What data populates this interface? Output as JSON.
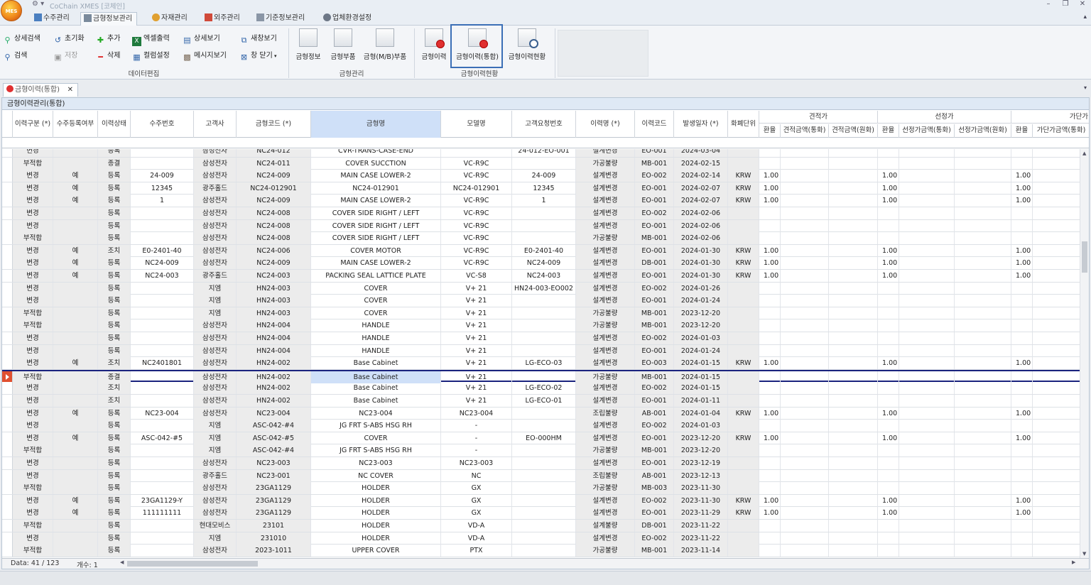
{
  "window": {
    "title": "CoChain XMES [코체인]",
    "logo_text": "MES"
  },
  "menu_tabs": [
    "수주관리",
    "금형정보관리",
    "자재관리",
    "외주관리",
    "기준정보관리",
    "업체환경설정"
  ],
  "ribbon": {
    "data_edit": {
      "label": "데이터편집",
      "buttons": [
        "상세검색",
        "검색",
        "초기화",
        "저장",
        "추가",
        "삭제",
        "엑셀출력",
        "컬럼설정",
        "상세보기",
        "메시지보기",
        "새창보기",
        "창 닫기"
      ]
    },
    "mold_mgmt": {
      "label": "금형관리",
      "buttons": [
        "금형정보",
        "금형부품",
        "금형(M/B)부품"
      ]
    },
    "mold_history": {
      "label": "금형이력현황",
      "buttons": [
        "금형이력",
        "금형이력(통합)",
        "금형이력현황"
      ]
    }
  },
  "doc_tab": "금형이력(통합)",
  "panel_title": "금형이력관리(통합)",
  "columns": [
    "이력구분 (*)",
    "수주등록여부",
    "이력상태",
    "수주번호",
    "고객사",
    "금형코드 (*)",
    "금형명",
    "모델명",
    "고객요청번호",
    "이력명 (*)",
    "이력코드",
    "발생일자 (*)",
    "화폐단위"
  ],
  "group_headers": {
    "estimate": "견적가",
    "selected": "선정가",
    "processing": "가단가"
  },
  "group_cols": {
    "estimate": [
      "환율",
      "견적금액(통화)",
      "견적금액(원화)"
    ],
    "selected": [
      "환율",
      "선정가금액(통화)",
      "선정가금액(원화)"
    ],
    "processing": [
      "환율",
      "가단가금액(통화)"
    ]
  },
  "rows": [
    [
      "변경",
      "",
      "등록",
      "",
      "삼성전자",
      "NC24-012",
      "CVR-TRANS-CASE-END",
      "",
      "24-012-EO-001",
      "설계변경",
      "EO-001",
      "2024-03-04",
      "",
      "",
      "",
      ""
    ],
    [
      "부적합",
      "",
      "종결",
      "",
      "삼성전자",
      "NC24-011",
      "COVER SUCCTION",
      "VC-R9C",
      "",
      "가공불량",
      "MB-001",
      "2024-02-15",
      "",
      "",
      "",
      ""
    ],
    [
      "변경",
      "예",
      "등록",
      "24-009",
      "삼성전자",
      "NC24-009",
      "MAIN CASE LOWER-2",
      "VC-R9C",
      "24-009",
      "설계변경",
      "EO-002",
      "2024-02-14",
      "KRW",
      "1.00",
      "1.00",
      "1.00"
    ],
    [
      "변경",
      "예",
      "등록",
      "12345",
      "광주홀드",
      "NC24-012901",
      "NC24-012901",
      "NC24-012901",
      "12345",
      "설계변경",
      "EO-001",
      "2024-02-07",
      "KRW",
      "1.00",
      "1.00",
      "1.00"
    ],
    [
      "변경",
      "예",
      "등록",
      "1",
      "삼성전자",
      "NC24-009",
      "MAIN CASE LOWER-2",
      "VC-R9C",
      "1",
      "설계변경",
      "EO-001",
      "2024-02-07",
      "KRW",
      "1.00",
      "1.00",
      "1.00"
    ],
    [
      "변경",
      "",
      "등록",
      "",
      "삼성전자",
      "NC24-008",
      "COVER SIDE RIGHT / LEFT",
      "VC-R9C",
      "",
      "설계변경",
      "EO-002",
      "2024-02-06",
      "",
      "",
      "",
      ""
    ],
    [
      "변경",
      "",
      "등록",
      "",
      "삼성전자",
      "NC24-008",
      "COVER SIDE RIGHT / LEFT",
      "VC-R9C",
      "",
      "설계변경",
      "EO-001",
      "2024-02-06",
      "",
      "",
      "",
      ""
    ],
    [
      "부적합",
      "",
      "등록",
      "",
      "삼성전자",
      "NC24-008",
      "COVER SIDE RIGHT / LEFT",
      "VC-R9C",
      "",
      "가공불량",
      "MB-001",
      "2024-02-06",
      "",
      "",
      "",
      ""
    ],
    [
      "변경",
      "예",
      "조치",
      "E0-2401-40",
      "삼성전자",
      "NC24-006",
      "COVER MOTOR",
      "VC-R9C",
      "E0-2401-40",
      "설계변경",
      "EO-001",
      "2024-01-30",
      "KRW",
      "1.00",
      "1.00",
      "1.00"
    ],
    [
      "변경",
      "예",
      "등록",
      "NC24-009",
      "삼성전자",
      "NC24-009",
      "MAIN CASE LOWER-2",
      "VC-R9C",
      "NC24-009",
      "설계변경",
      "DB-001",
      "2024-01-30",
      "KRW",
      "1.00",
      "1.00",
      "1.00"
    ],
    [
      "변경",
      "예",
      "등록",
      "NC24-003",
      "광주홀드",
      "NC24-003",
      "PACKING SEAL LATTICE PLATE",
      "VC-S8",
      "NC24-003",
      "설계변경",
      "EO-001",
      "2024-01-30",
      "KRW",
      "1.00",
      "1.00",
      "1.00"
    ],
    [
      "변경",
      "",
      "등록",
      "",
      "지엠",
      "HN24-003",
      "COVER",
      "V+ 21",
      "HN24-003-EO002",
      "설계변경",
      "EO-002",
      "2024-01-26",
      "",
      "",
      "",
      ""
    ],
    [
      "변경",
      "",
      "등록",
      "",
      "지엠",
      "HN24-003",
      "COVER",
      "V+ 21",
      "",
      "설계변경",
      "EO-001",
      "2024-01-24",
      "",
      "",
      "",
      ""
    ],
    [
      "부적합",
      "",
      "등록",
      "",
      "지엠",
      "HN24-003",
      "COVER",
      "V+ 21",
      "",
      "가공불량",
      "MB-001",
      "2023-12-20",
      "",
      "",
      "",
      ""
    ],
    [
      "부적합",
      "",
      "등록",
      "",
      "삼성전자",
      "HN24-004",
      "HANDLE",
      "V+ 21",
      "",
      "가공불량",
      "MB-001",
      "2023-12-20",
      "",
      "",
      "",
      ""
    ],
    [
      "변경",
      "",
      "등록",
      "",
      "삼성전자",
      "HN24-004",
      "HANDLE",
      "V+ 21",
      "",
      "설계변경",
      "EO-002",
      "2024-01-03",
      "",
      "",
      "",
      ""
    ],
    [
      "변경",
      "",
      "등록",
      "",
      "삼성전자",
      "HN24-004",
      "HANDLE",
      "V+ 21",
      "",
      "설계변경",
      "EO-001",
      "2024-01-24",
      "",
      "",
      "",
      ""
    ],
    [
      "변경",
      "예",
      "조치",
      "NC2401801",
      "삼성전자",
      "HN24-002",
      "Base Cabinet",
      "V+ 21",
      "LG-ECO-03",
      "설계변경",
      "EO-003",
      "2024-01-15",
      "KRW",
      "1.00",
      "1.00",
      "1.00"
    ],
    [
      "부적합",
      "",
      "종결",
      "",
      "삼성전자",
      "HN24-002",
      "Base Cabinet",
      "V+ 21",
      "",
      "가공불량",
      "MB-001",
      "2024-01-15",
      "",
      "",
      "",
      ""
    ],
    [
      "변경",
      "",
      "조치",
      "",
      "삼성전자",
      "HN24-002",
      "Base Cabinet",
      "V+ 21",
      "LG-ECO-02",
      "설계변경",
      "EO-002",
      "2024-01-15",
      "",
      "",
      "",
      ""
    ],
    [
      "변경",
      "",
      "조치",
      "",
      "삼성전자",
      "HN24-002",
      "Base Cabinet",
      "V+ 21",
      "LG-ECO-01",
      "설계변경",
      "EO-001",
      "2024-01-11",
      "",
      "",
      "",
      ""
    ],
    [
      "변경",
      "예",
      "등록",
      "NC23-004",
      "삼성전자",
      "NC23-004",
      "NC23-004",
      "NC23-004",
      "",
      "조립불량",
      "AB-001",
      "2024-01-04",
      "KRW",
      "1.00",
      "1.00",
      "1.00"
    ],
    [
      "변경",
      "",
      "등록",
      "",
      "지엠",
      "ASC-042-#4",
      "JG FRT S-ABS HSG RH",
      "-",
      "",
      "설계변경",
      "EO-002",
      "2024-01-03",
      "",
      "",
      "",
      ""
    ],
    [
      "변경",
      "예",
      "등록",
      "ASC-042-#5",
      "지엠",
      "ASC-042-#5",
      "COVER",
      "-",
      "EO-000HM",
      "설계변경",
      "EO-001",
      "2023-12-20",
      "KRW",
      "1.00",
      "1.00",
      "1.00"
    ],
    [
      "부적합",
      "",
      "등록",
      "",
      "지엠",
      "ASC-042-#4",
      "JG FRT S-ABS HSG RH",
      "-",
      "",
      "가공불량",
      "MB-001",
      "2023-12-20",
      "",
      "",
      "",
      ""
    ],
    [
      "변경",
      "",
      "등록",
      "",
      "삼성전자",
      "NC23-003",
      "NC23-003",
      "NC23-003",
      "",
      "설계변경",
      "EO-001",
      "2023-12-19",
      "",
      "",
      "",
      ""
    ],
    [
      "변경",
      "",
      "등록",
      "",
      "광주홀드",
      "NC23-001",
      "NC COVER",
      "NC",
      "",
      "조립불량",
      "AB-001",
      "2023-12-13",
      "",
      "",
      "",
      ""
    ],
    [
      "부적합",
      "",
      "등록",
      "",
      "삼성전자",
      "23GA1129",
      "HOLDER",
      "GX",
      "",
      "가공불량",
      "MB-003",
      "2023-11-30",
      "",
      "",
      "",
      ""
    ],
    [
      "변경",
      "예",
      "등록",
      "23GA1129-Y",
      "삼성전자",
      "23GA1129",
      "HOLDER",
      "GX",
      "",
      "설계변경",
      "EO-002",
      "2023-11-30",
      "KRW",
      "1.00",
      "1.00",
      "1.00"
    ],
    [
      "변경",
      "예",
      "등록",
      "111111111",
      "삼성전자",
      "23GA1129",
      "HOLDER",
      "GX",
      "",
      "설계변경",
      "EO-001",
      "2023-11-29",
      "KRW",
      "1.00",
      "1.00",
      "1.00"
    ],
    [
      "부적합",
      "",
      "등록",
      "",
      "현대모비스",
      "23101",
      "HOLDER",
      "VD-A",
      "",
      "설계불량",
      "DB-001",
      "2023-11-22",
      "",
      "",
      "",
      ""
    ],
    [
      "변경",
      "",
      "등록",
      "",
      "지엠",
      "231010",
      "HOLDER",
      "VD-A",
      "",
      "설계변경",
      "EO-002",
      "2023-11-22",
      "",
      "",
      "",
      ""
    ],
    [
      "부적합",
      "",
      "등록",
      "",
      "삼성전자",
      "2023-1011",
      "UPPER COVER",
      "PTX",
      "",
      "가공불량",
      "MB-001",
      "2023-11-14",
      "",
      "",
      "",
      ""
    ]
  ],
  "current_row": 18,
  "footer": {
    "data": "Data: 41 / 123",
    "count": "개수: 1"
  }
}
